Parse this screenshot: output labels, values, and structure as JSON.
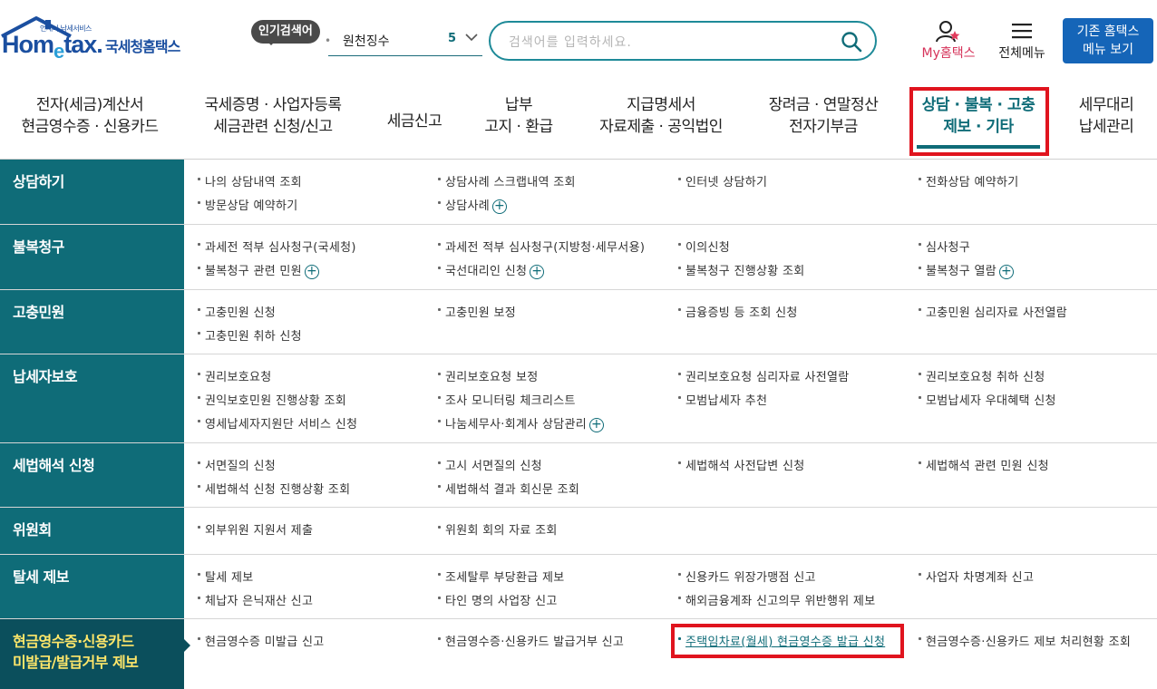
{
  "header": {
    "logo_sub": "언제나 납세서비스",
    "logo_main_a": "Hom",
    "logo_main_e": "e",
    "logo_main_b": "tax.",
    "logo_name": "국세청홈택스",
    "popular_badge": "인기검색어",
    "popular_word": "원천징수",
    "popular_rank": "5",
    "search_placeholder": "검색어를 입력하세요.",
    "my_hometax": "My홈택스",
    "all_menu": "전체메뉴",
    "old_menu_line1": "기존 홈택스",
    "old_menu_line2": "메뉴 보기"
  },
  "gnb": [
    {
      "line1": "전자(세금)계산서",
      "line2": "현금영수증 · 신용카드"
    },
    {
      "line1": "국세증명 · 사업자등록",
      "line2": "세금관련 신청/신고"
    },
    {
      "line1": "세금신고",
      "line2": ""
    },
    {
      "line1": "납부",
      "line2": "고지 · 환급"
    },
    {
      "line1": "지급명세서",
      "line2": "자료제출 · 공익법인"
    },
    {
      "line1": "장려금 · 연말정산",
      "line2": "전자기부금"
    },
    {
      "line1": "상담 · 불복 · 고충",
      "line2": "제보 · 기타"
    },
    {
      "line1": "세무대리",
      "line2": "납세관리"
    }
  ],
  "sections": [
    {
      "title_1": "상담하기",
      "title_2": "",
      "links": [
        "나의 상담내역 조회",
        "상담사례 스크랩내역 조회",
        "인터넷 상담하기",
        "전화상담 예약하기",
        "방문상담 예약하기",
        "상담사례"
      ]
    },
    {
      "title_1": "불복청구",
      "title_2": "",
      "links": [
        "과세전 적부 심사청구(국세청)",
        "과세전 적부 심사청구(지방청·세무서용)",
        "이의신청",
        "심사청구",
        "불복청구 관련 민원",
        "국선대리인 신청",
        "불복청구 진행상황 조회",
        "불복청구 열람"
      ]
    },
    {
      "title_1": "고충민원",
      "title_2": "",
      "links": [
        "고충민원 신청",
        "고충민원 보정",
        "금융증빙 등 조회 신청",
        "고충민원 심리자료 사전열람",
        "고충민원 취하 신청"
      ]
    },
    {
      "title_1": "납세자보호",
      "title_2": "",
      "links": [
        "권리보호요청",
        "권리보호요청 보정",
        "권리보호요청 심리자료 사전열람",
        "권리보호요청 취하 신청",
        "권익보호민원 진행상황 조회",
        "조사 모니터링 체크리스트",
        "모범납세자 추천",
        "모범납세자 우대혜택 신청",
        "영세납세자지원단 서비스 신청",
        "나눔세무사·회계사 상담관리"
      ]
    },
    {
      "title_1": "세법해석 신청",
      "title_2": "",
      "links": [
        "서면질의 신청",
        "고시 서면질의 신청",
        "세법해석 사전답변 신청",
        "세법해석 관련 민원 신청",
        "세법해석 신청 진행상황 조회",
        "세법해석 결과 회신문 조회"
      ]
    },
    {
      "title_1": "위원회",
      "title_2": "",
      "links": [
        "외부위원 지원서 제출",
        "위원회 회의 자료 조회"
      ]
    },
    {
      "title_1": "탈세 제보",
      "title_2": "",
      "links": [
        "탈세 제보",
        "조세탈루 부당환급 제보",
        "신용카드 위장가맹점 신고",
        "사업자 차명계좌 신고",
        "체납자 은닉재산 신고",
        "타인 명의 사업장 신고",
        "해외금융계좌 신고의무 위반행위 제보"
      ]
    },
    {
      "title_1": "현금영수증·신용카드",
      "title_2": "미발급/발급거부 제보",
      "links": [
        "현금영수증 미발급 신고",
        "현금영수증·신용카드 발급거부 신고",
        "주택임차료(월세) 현금영수증 발급 신청",
        "현금영수증·신용카드 제보 처리현황 조회"
      ]
    }
  ]
}
